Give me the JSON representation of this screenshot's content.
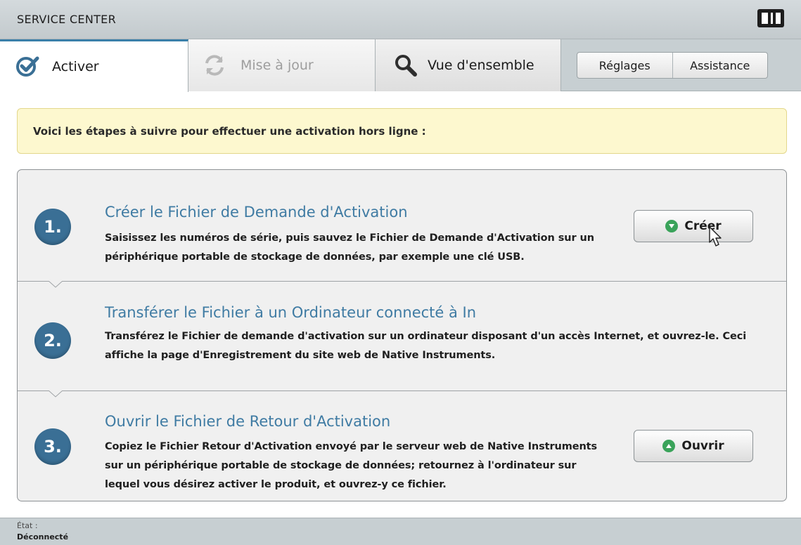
{
  "window": {
    "title": "SERVICE CENTER",
    "logo_icon": "native-instruments-logo"
  },
  "tabs": [
    {
      "label": "Activer",
      "icon": "checkmark-badge-icon",
      "active": true
    },
    {
      "label": "Mise à jour",
      "icon": "refresh-icon",
      "active": false,
      "disabled": true
    },
    {
      "label": "Vue d'ensemble",
      "icon": "magnifier-icon",
      "active": false
    }
  ],
  "toolbar": {
    "settings_label": "Réglages",
    "support_label": "Assistance"
  },
  "banner": {
    "text": "Voici les étapes à suivre pour effectuer une activation hors ligne :"
  },
  "steps": [
    {
      "number": "1.",
      "title": "Créer le Fichier de Demande d'Activation",
      "description": "Saisissez les numéros de série, puis sauvez le Fichier de Demande d'Activation sur un périphérique portable de stockage de données, par exemple une clé USB.",
      "button_label": "Créer"
    },
    {
      "number": "2.",
      "title": "Transférer le Fichier à un Ordinateur connecté à In",
      "description": "Transférez le Fichier de demande d'activation sur un ordinateur disposant d'un accès Internet, et ouvrez-le. Ceci affiche la page d'Enregistrement du site web de Native Instruments."
    },
    {
      "number": "3.",
      "title": "Ouvrir le Fichier de Retour d'Activation",
      "description": "Copiez le Fichier Retour d'Activation envoyé par le serveur web de Native Instruments sur un périphérique portable de stockage de données; retournez à l'ordinateur sur lequel vous désirez activer le produit, et ouvrez-y ce fichier.",
      "button_label": "Ouvrir"
    }
  ],
  "status": {
    "label": "État :",
    "value": "Déconnecté"
  },
  "colors": {
    "accent": "#3f7ba3",
    "step_circle": "#3a6f95",
    "banner_bg": "#fdf8cf",
    "button_icon": "#3aa35a"
  }
}
